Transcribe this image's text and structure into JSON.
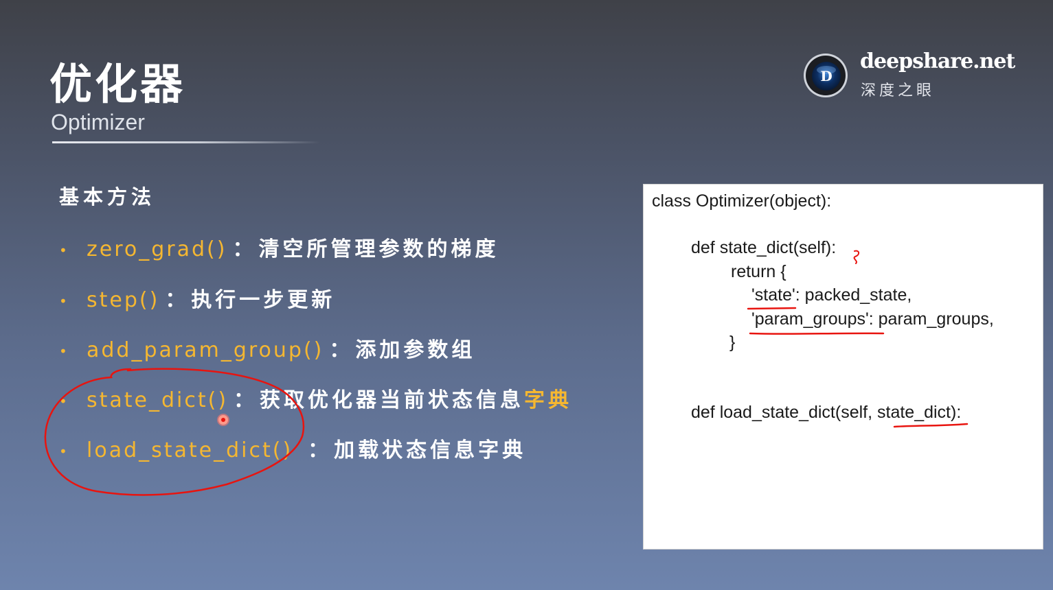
{
  "slide": {
    "title": "优化器",
    "subtitle": "Optimizer"
  },
  "brand": {
    "name": "deepshare.net",
    "subtitle": "深度之眼",
    "logo_letter": "D",
    "logo_icon": "eye-logo-icon"
  },
  "section": {
    "heading": "基本方法"
  },
  "methods": [
    {
      "fn": "zero_grad()",
      "colon": "：",
      "desc": "清空所管理参数的梯度",
      "desc_highlight": ""
    },
    {
      "fn": "step()",
      "colon": "：",
      "desc": "执行一步更新",
      "desc_highlight": ""
    },
    {
      "fn": "add_param_group()",
      "colon": "：",
      "desc": "添加参数组",
      "desc_highlight": ""
    },
    {
      "fn": "state_dict()",
      "colon": "：",
      "desc": "获取优化器当前状态信息",
      "desc_highlight": "字典"
    },
    {
      "fn": "load_state_dict()",
      "colon": "：",
      "desc": "加载状态信息字典",
      "desc_highlight": ""
    }
  ],
  "code": {
    "lines": [
      "class Optimizer(object):",
      "def state_dict(self):",
      "return {",
      "'state': packed_state,",
      "'param_groups': param_groups,",
      "}",
      "def load_state_dict(self, state_dict):"
    ]
  },
  "colors": {
    "accent": "#f5b731",
    "annotation": "#e8140f",
    "code_background": "#ffffff"
  },
  "annotations": {
    "bullet_glyph": "•",
    "marks": [
      "ink-circle",
      "ink-underline",
      "cursor-dot"
    ]
  }
}
